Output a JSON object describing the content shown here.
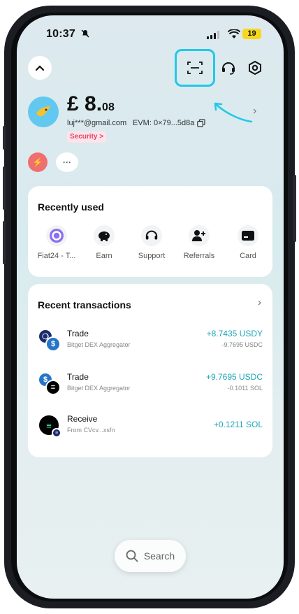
{
  "status": {
    "time": "10:37",
    "battery": "19"
  },
  "header": {
    "collapse_icon": "chevron-up-icon",
    "scan_icon": "scan-icon",
    "support_icon": "headset-icon",
    "settings_icon": "hexagon-settings-icon"
  },
  "account": {
    "balance_main": "£ 8.",
    "balance_decimals": "08",
    "email": "luj***@gmail.com",
    "evm": "EVM: 0×79...5d8a",
    "security_label": "Security >"
  },
  "quick_chips": {
    "more": "···"
  },
  "recently_used": {
    "title": "Recently used",
    "items": [
      {
        "label": "Fiat24 - T...",
        "icon": "fiat24-icon"
      },
      {
        "label": "Earn",
        "icon": "piggy-bank-icon"
      },
      {
        "label": "Support",
        "icon": "headset-icon"
      },
      {
        "label": "Referrals",
        "icon": "add-user-icon"
      },
      {
        "label": "Card",
        "icon": "card-icon"
      }
    ]
  },
  "transactions": {
    "title": "Recent transactions",
    "items": [
      {
        "title": "Trade",
        "sub": "Bitget DEX Aggregator",
        "amount": "+8.7435 USDY",
        "amount_sub": "-9.7695 USDC"
      },
      {
        "title": "Trade",
        "sub": "Bitget DEX Aggregator",
        "amount": "+9.7695 USDC",
        "amount_sub": "-0.1011 SOL"
      },
      {
        "title": "Receive",
        "sub": "From CVcv...xsfn",
        "amount": "+0.1211 SOL",
        "amount_sub": ""
      }
    ]
  },
  "search": {
    "label": "Search"
  },
  "colors": {
    "accent": "#1fa6b8",
    "highlight": "#22c8e8",
    "security": "#e0446a"
  }
}
